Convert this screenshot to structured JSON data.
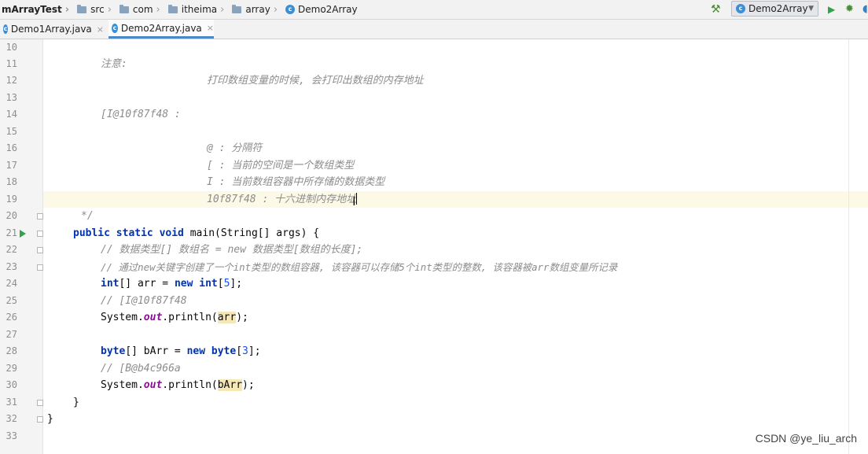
{
  "navbar": {
    "crumbs": [
      "mArrayTest",
      "src",
      "com",
      "itheima",
      "array",
      "Demo2Array"
    ],
    "run_config": "Demo2Array"
  },
  "tabs": [
    {
      "label": "Demo1Array.java",
      "active": false
    },
    {
      "label": "Demo2Array.java",
      "active": true
    }
  ],
  "editor": {
    "line_numbers": [
      "10",
      "11",
      "12",
      "13",
      "14",
      "15",
      "16",
      "17",
      "18",
      "19",
      "20",
      "21",
      "22",
      "23",
      "24",
      "25",
      "26",
      "27",
      "28",
      "29",
      "30",
      "31",
      "32",
      "33"
    ],
    "code": {
      "l11": "注意:",
      "l12": "打印数组变量的时候, 会打印出数组的内存地址",
      "l14": "[I@10f87f48 :",
      "l16": "@ : 分隔符",
      "l17": "[ : 当前的空间是一个数组类型",
      "l18": "I : 当前数组容器中所存储的数据类型",
      "l19a": "10f87f48 : 十六进制内存",
      "l19b": "地址",
      "l20": "*/",
      "l21_kw": "public static void",
      "l21_rest": " main(String[] args) {",
      "l22": "// 数据类型[] 数组名 = new 数据类型[数组的长度];",
      "l23": "// 通过new关键字创建了一个int类型的数组容器, 该容器可以存储5个int类型的整数, 该容器被arr数组变量所记录",
      "l24_kw1": "int",
      "l24_mid": "[] arr = ",
      "l24_kw2": "new int",
      "l24_open": "[",
      "l24_num": "5",
      "l24_close": "];",
      "l25": "// [I@10f87f48",
      "l26_a": "System.",
      "l26_fld": "out",
      "l26_b": ".println(",
      "l26_var": "arr",
      "l26_c": ");",
      "l28_kw1": "byte",
      "l28_mid": "[] bArr = ",
      "l28_kw2": "new byte",
      "l28_open": "[",
      "l28_num": "3",
      "l28_close": "];",
      "l29": "// [B@b4c966a",
      "l30_a": "System.",
      "l30_fld": "out",
      "l30_b": ".println(",
      "l30_var": "bArr",
      "l30_c": ");",
      "l31": "}",
      "l32": "}"
    }
  },
  "watermark": "CSDN @ye_liu_arch",
  "colors": {
    "keyword": "#0033b3",
    "comment": "#8c8c8c",
    "number": "#1750eb",
    "field": "#871094",
    "run": "#2fa24a"
  }
}
